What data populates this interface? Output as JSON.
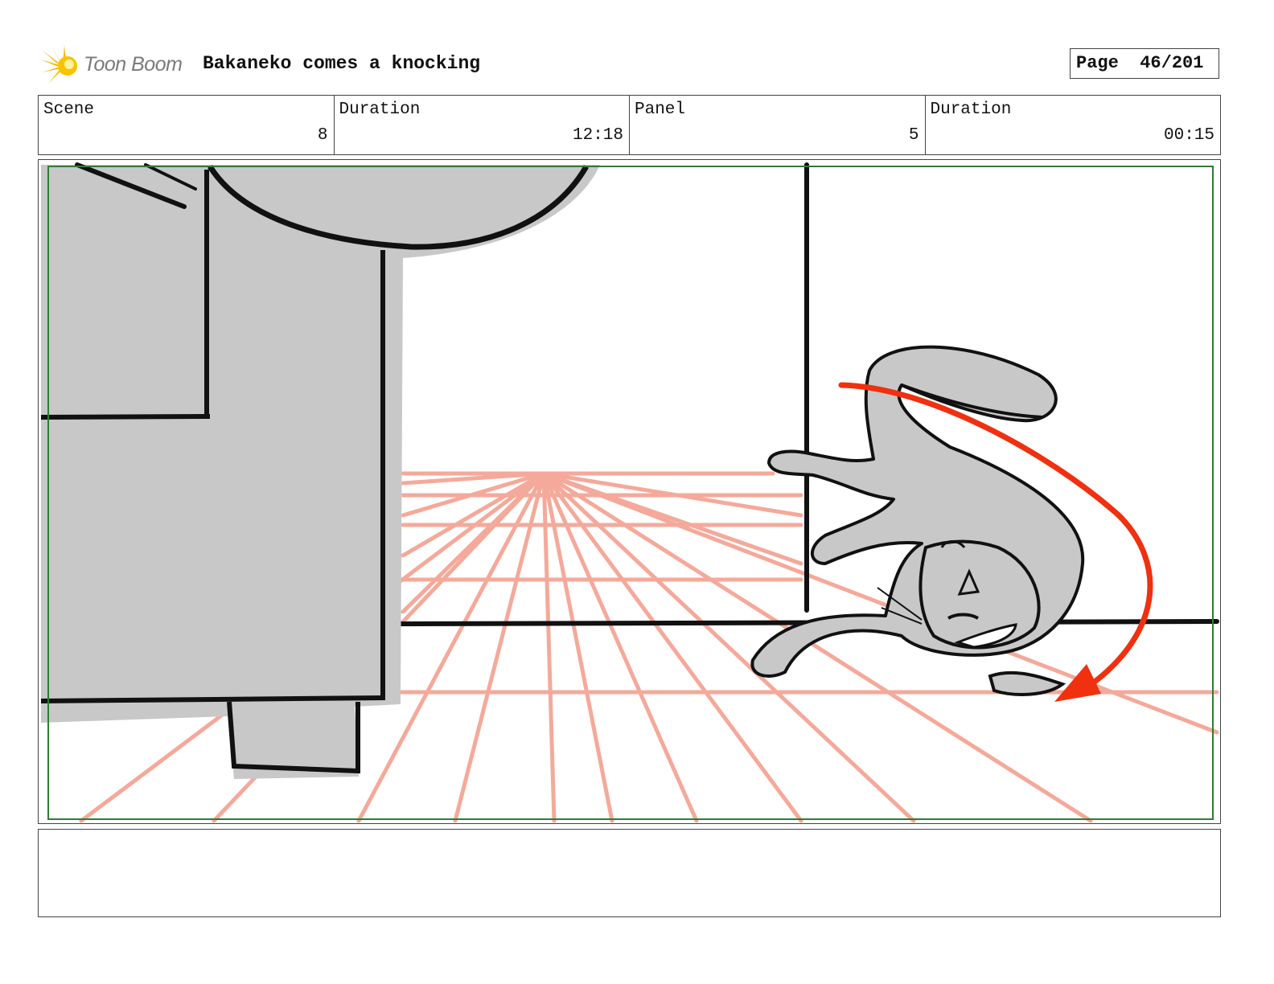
{
  "header": {
    "logo_text": "Toon Boom",
    "logo_icon": "starburst-icon",
    "title": "Bakaneko comes a knocking",
    "page_label": "Page",
    "page_value": "46/201"
  },
  "info": [
    {
      "label": "Scene",
      "value": "8"
    },
    {
      "label": "Duration",
      "value": "12:18"
    },
    {
      "label": "Panel",
      "value": "5"
    },
    {
      "label": "Duration",
      "value": "00:15"
    }
  ],
  "panel": {
    "description_visual": "storyboard-sketch-cat-falling",
    "colors": {
      "safe_frame": "#2e7d32",
      "perspective_lines": "#f5a99a",
      "motion_arrow": "#f0300f",
      "fill_gray": "#c8c8c8",
      "ink": "#111111"
    }
  },
  "notes": {
    "text": ""
  }
}
